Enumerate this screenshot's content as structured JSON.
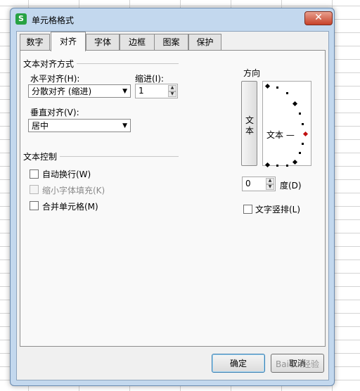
{
  "window": {
    "title": "单元格格式",
    "app_icon": "S",
    "close_icon": "✕"
  },
  "tabs": [
    {
      "label": "数字",
      "active": false
    },
    {
      "label": "对齐",
      "active": true
    },
    {
      "label": "字体",
      "active": false
    },
    {
      "label": "边框",
      "active": false
    },
    {
      "label": "图案",
      "active": false
    },
    {
      "label": "保护",
      "active": false
    }
  ],
  "alignment": {
    "group_title": "文本对齐方式",
    "horizontal_label": "水平对齐(H):",
    "horizontal_value": "分散对齐 (缩进)",
    "indent_label": "缩进(I):",
    "indent_value": "1",
    "vertical_label": "垂直对齐(V):",
    "vertical_value": "居中"
  },
  "text_control": {
    "group_title": "文本控制",
    "wrap_text": {
      "label": "自动换行(W)",
      "checked": false,
      "enabled": true
    },
    "shrink_to_fit": {
      "label": "缩小字体填充(K)",
      "checked": false,
      "enabled": false
    },
    "merge_cells": {
      "label": "合并单元格(M)",
      "checked": false,
      "enabled": true
    }
  },
  "orientation": {
    "group_title": "方向",
    "vertical_text_label": "文本",
    "dial_text": "文本 —",
    "degrees_value": "0",
    "degrees_label": "度(D)",
    "stacked_text": {
      "label": "文字竖排(L)",
      "checked": false
    }
  },
  "buttons": {
    "ok_label": "确定",
    "cancel_label": "取消"
  },
  "watermark": "Baidu 经验",
  "colors": {
    "title_bar": "#c3d8ee",
    "close_button": "#c7422a",
    "app_icon": "#27a243",
    "dial_marker": "#c01010"
  }
}
